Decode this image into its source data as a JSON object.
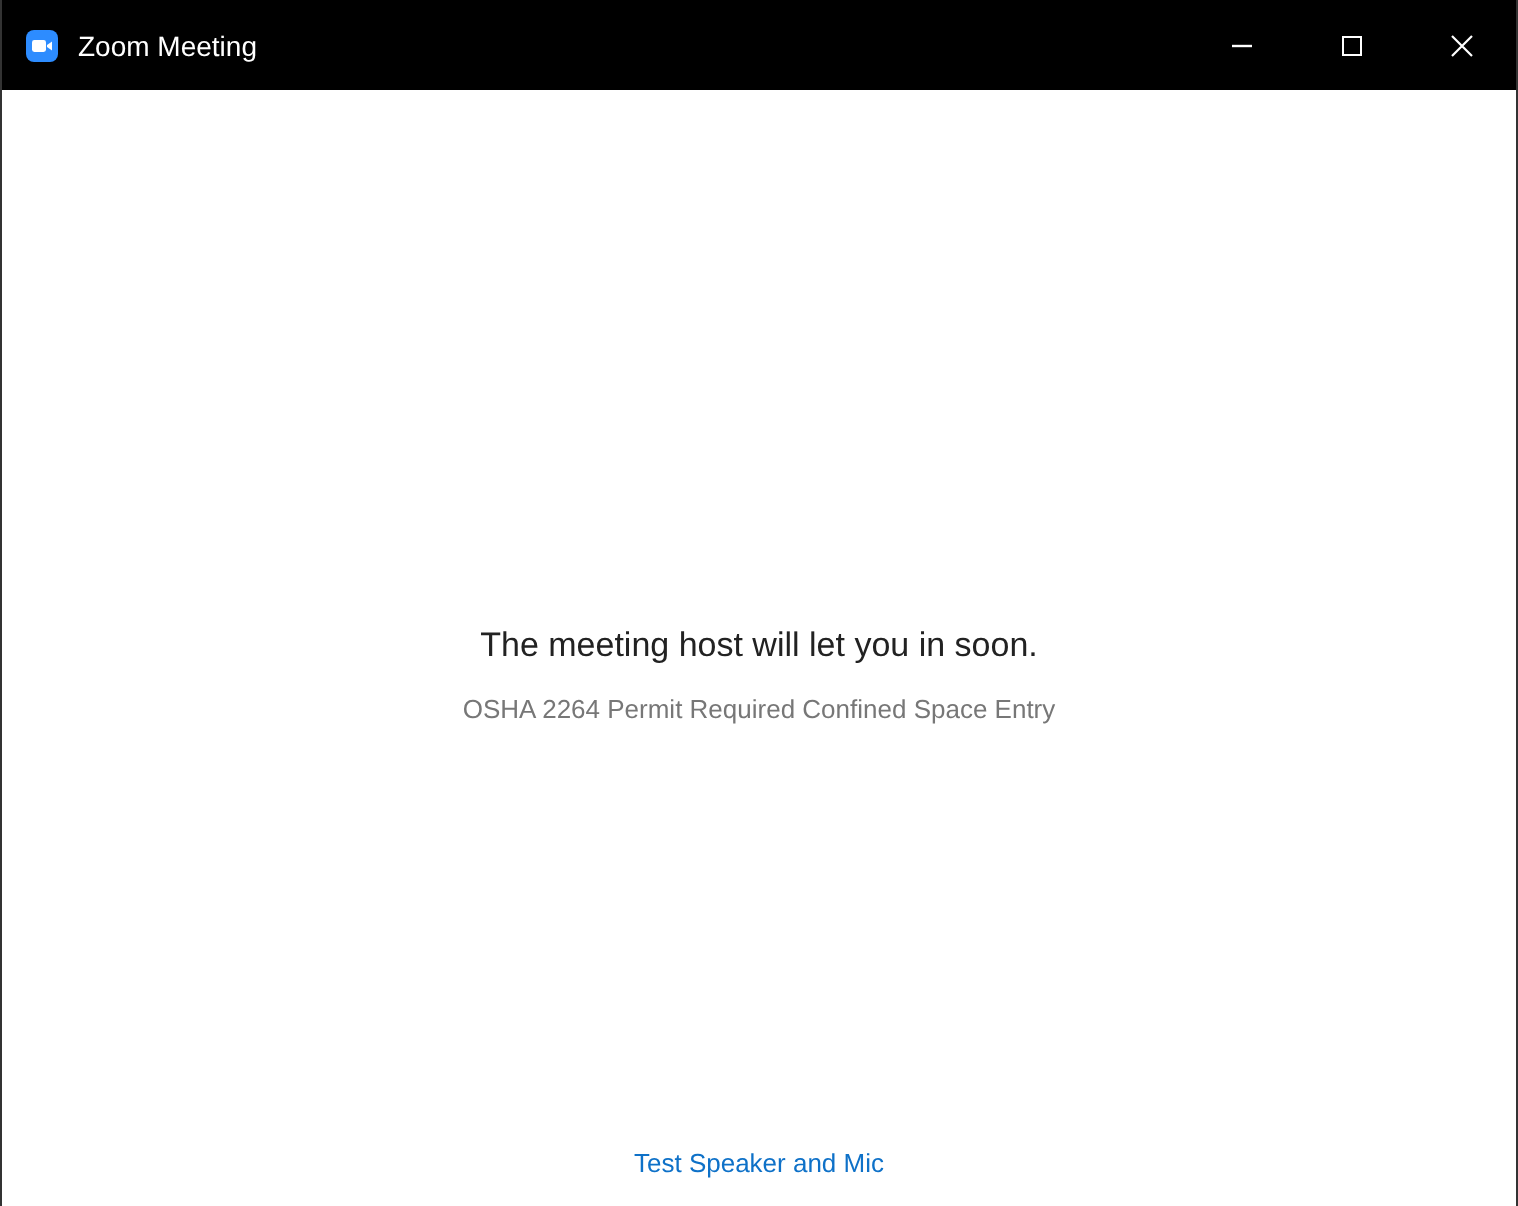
{
  "window": {
    "title": "Zoom Meeting"
  },
  "message": {
    "headline": "The meeting host will let you in soon.",
    "subtitle": "OSHA 2264 Permit Required Confined Space Entry"
  },
  "link": "Test Speaker and Mic"
}
